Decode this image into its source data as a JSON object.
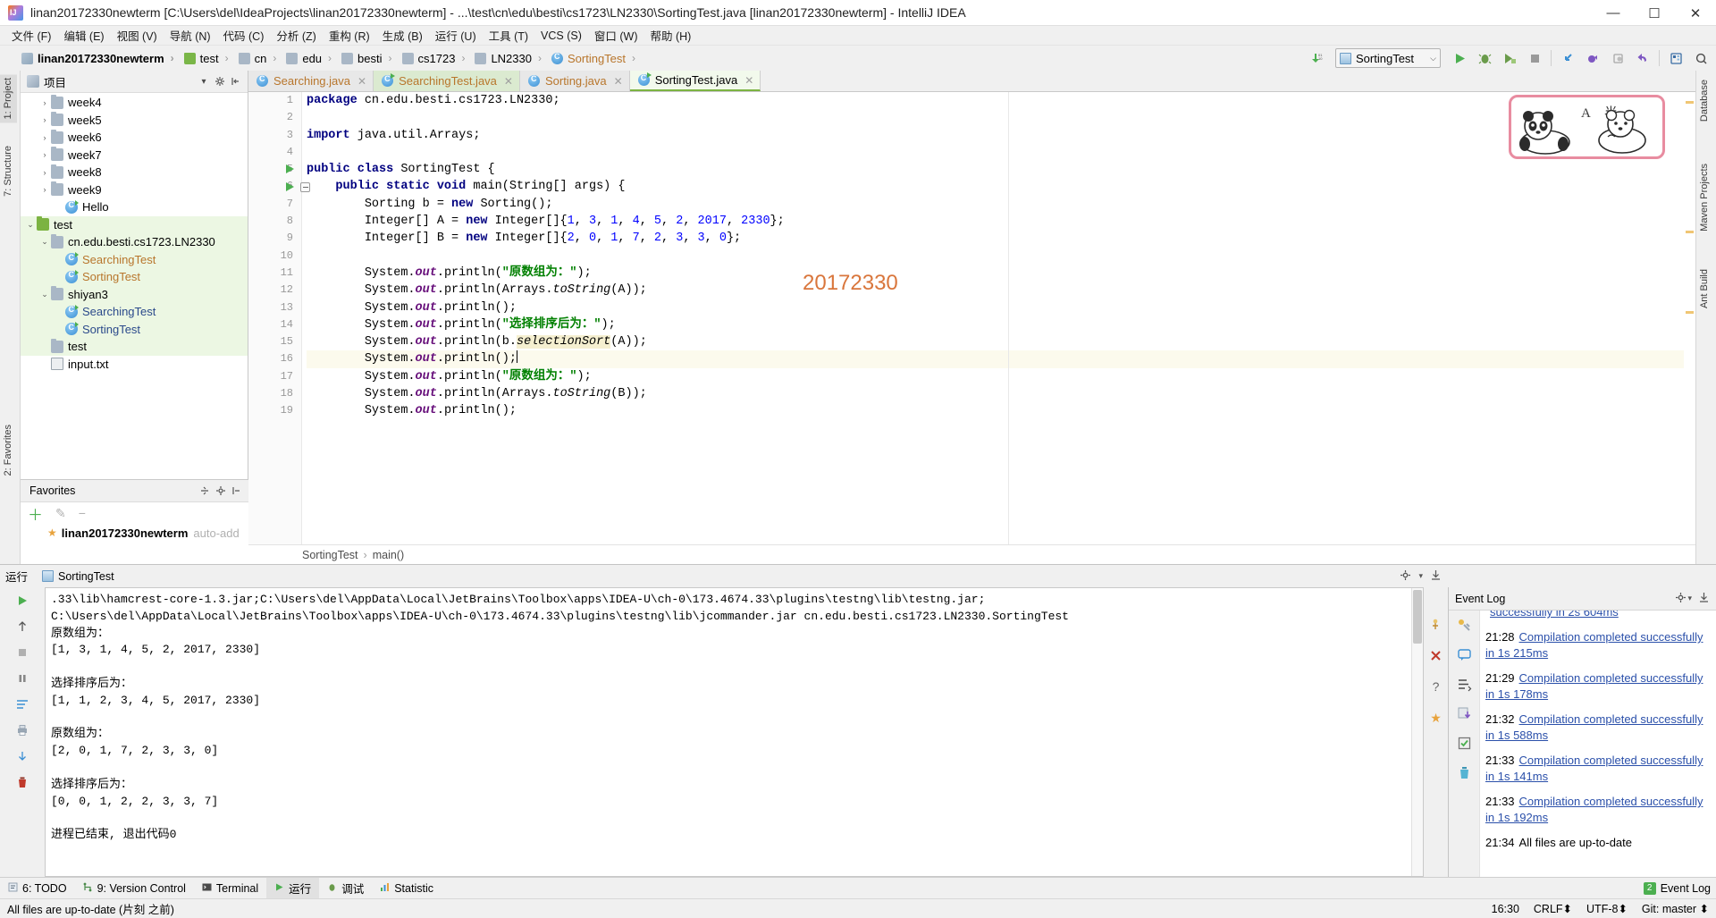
{
  "window": {
    "title": "linan20172330newterm [C:\\Users\\del\\IdeaProjects\\linan20172330newterm] - ...\\test\\cn\\edu\\besti\\cs1723\\LN2330\\SortingTest.java [linan20172330newterm] - IntelliJ IDEA",
    "app_icon": "IJ",
    "minimize": "—",
    "maximize": "☐",
    "close": "✕"
  },
  "menubar": {
    "items": [
      "文件 (F)",
      "编辑 (E)",
      "视图 (V)",
      "导航 (N)",
      "代码 (C)",
      "分析 (Z)",
      "重构 (R)",
      "生成 (B)",
      "运行 (U)",
      "工具 (T)",
      "VCS (S)",
      "窗口 (W)",
      "帮助 (H)"
    ]
  },
  "navbar": {
    "breadcrumbs": [
      {
        "label": "linan20172330newterm",
        "icon": "project-icon",
        "bold": true
      },
      {
        "label": "test",
        "icon": "folder-green-icon",
        "bold": false
      },
      {
        "label": "cn",
        "icon": "folder-icon",
        "bold": false
      },
      {
        "label": "edu",
        "icon": "folder-icon",
        "bold": false
      },
      {
        "label": "besti",
        "icon": "folder-icon",
        "bold": false
      },
      {
        "label": "cs1723",
        "icon": "folder-icon",
        "bold": false
      },
      {
        "label": "LN2330",
        "icon": "folder-icon",
        "bold": false
      },
      {
        "label": "SortingTest",
        "icon": "class-icon",
        "bold": false,
        "orange": true
      }
    ],
    "separator": "›",
    "run_config": "SortingTest",
    "run_config_chevron": "⌵",
    "update_icon": "download-updates-icon",
    "buttons": [
      {
        "name": "run-button",
        "glyph": "▶",
        "color": "#4caf50"
      },
      {
        "name": "debug-button",
        "glyph": "🐞",
        "color": "#6a9b4b"
      },
      {
        "name": "run-with-coverage-button",
        "glyph": "▶",
        "color": "#6a9b4b"
      },
      {
        "name": "stop-button",
        "glyph": "■",
        "color": "#9a9a9a"
      },
      {
        "name": "step-into-button",
        "glyph": "↙",
        "color": "#3b8fd4"
      },
      {
        "name": "toggle-breakpoint-button",
        "glyph": "●",
        "color": "#6a4b9b"
      },
      {
        "name": "view-breakpoints-button",
        "glyph": "◑",
        "color": "#9a9a9a"
      },
      {
        "name": "undo-button",
        "glyph": "↶",
        "color": "#6a4b9b"
      },
      {
        "name": "project-structure-button",
        "glyph": "▤",
        "color": "#3b6ea5"
      },
      {
        "name": "search-everywhere-button",
        "glyph": "⌕",
        "color": "#4a4a4a"
      }
    ]
  },
  "left_stripe": {
    "tabs": [
      {
        "label": "1: Project",
        "selected": true
      },
      {
        "label": "7: Structure",
        "selected": false
      },
      {
        "label": "2: Favorites",
        "selected": false
      }
    ]
  },
  "right_stripe": {
    "tabs": [
      "Database",
      "Maven Projects",
      "Ant Build"
    ]
  },
  "project_panel": {
    "title": "项目",
    "icon": "project-view-icon",
    "chevron": "▾",
    "settings_icon": "gear-icon",
    "collapse_icon": "collapse-all-icon",
    "tree": [
      {
        "label": "week4",
        "indent": 1,
        "arrow": "›",
        "icon": "folder-icon",
        "style": "normal"
      },
      {
        "label": "week5",
        "indent": 1,
        "arrow": "›",
        "icon": "folder-icon",
        "style": "normal"
      },
      {
        "label": "week6",
        "indent": 1,
        "arrow": "›",
        "icon": "folder-icon",
        "style": "normal"
      },
      {
        "label": "week7",
        "indent": 1,
        "arrow": "›",
        "icon": "folder-icon",
        "style": "normal"
      },
      {
        "label": "week8",
        "indent": 1,
        "arrow": "›",
        "icon": "folder-icon",
        "style": "normal"
      },
      {
        "label": "week9",
        "indent": 1,
        "arrow": "›",
        "icon": "folder-icon",
        "style": "normal"
      },
      {
        "label": "Hello",
        "indent": 2,
        "arrow": "",
        "icon": "class-icon-run",
        "style": "normal"
      },
      {
        "label": "test",
        "indent": 0,
        "arrow": "⌄",
        "icon": "folder-green-icon",
        "style": "green"
      },
      {
        "label": "cn.edu.besti.cs1723.LN2330",
        "indent": 1,
        "arrow": "⌄",
        "icon": "folder-icon",
        "style": "green"
      },
      {
        "label": "SearchingTest",
        "indent": 2,
        "arrow": "",
        "icon": "class-icon-run",
        "style": "green-orange"
      },
      {
        "label": "SortingTest",
        "indent": 2,
        "arrow": "",
        "icon": "class-icon-run",
        "style": "green-orange"
      },
      {
        "label": "shiyan3",
        "indent": 1,
        "arrow": "⌄",
        "icon": "folder-icon",
        "style": "green"
      },
      {
        "label": "SearchingTest",
        "indent": 2,
        "arrow": "",
        "icon": "class-icon-run",
        "style": "green-blue"
      },
      {
        "label": "SortingTest",
        "indent": 2,
        "arrow": "",
        "icon": "class-icon-run",
        "style": "green-blue"
      },
      {
        "label": "test",
        "indent": 1,
        "arrow": "",
        "icon": "folder-icon",
        "style": "green"
      },
      {
        "label": "input.txt",
        "indent": 1,
        "arrow": "",
        "icon": "text-file-icon",
        "style": "normal"
      }
    ]
  },
  "favorites_panel": {
    "title": "Favorites",
    "toolbar_icons": [
      "split-icon",
      "gear-icon",
      "collapse-icon"
    ],
    "actions": [
      "＋",
      "✎",
      "−"
    ],
    "item": "linan20172330newterm",
    "item_suffix": "auto-add"
  },
  "editor": {
    "tabs": [
      {
        "label": "Searching.java",
        "icon": "java-class-icon",
        "state": "inactive",
        "close": "✕"
      },
      {
        "label": "SearchingTest.java",
        "icon": "java-test-class-icon",
        "state": "modified",
        "close": "✕"
      },
      {
        "label": "Sorting.java",
        "icon": "java-class-icon",
        "state": "inactive",
        "close": "✕"
      },
      {
        "label": "SortingTest.java",
        "icon": "java-test-class-icon",
        "state": "active",
        "close": "✕"
      }
    ],
    "watermark": "20172330",
    "breadcrumb": {
      "class": "SortingTest",
      "method": "main()",
      "separator": "›"
    },
    "first_line": 1,
    "lines": [
      {
        "n": 1,
        "segments": [
          {
            "t": "package ",
            "c": "kw"
          },
          {
            "t": "cn.edu.besti.cs1723.LN2330;",
            "c": ""
          }
        ],
        "indent": 0
      },
      {
        "n": 2,
        "segments": [],
        "indent": 0
      },
      {
        "n": 3,
        "segments": [
          {
            "t": "import ",
            "c": "kw"
          },
          {
            "t": "java.util.Arrays;",
            "c": ""
          }
        ],
        "indent": 0
      },
      {
        "n": 4,
        "segments": [],
        "indent": 0
      },
      {
        "n": 5,
        "segments": [
          {
            "t": "public class ",
            "c": "kw"
          },
          {
            "t": "SortingTest {",
            "c": ""
          }
        ],
        "indent": 0,
        "gutter": "run"
      },
      {
        "n": 6,
        "segments": [
          {
            "t": "public static void ",
            "c": "kw"
          },
          {
            "t": "main(String[] args) {",
            "c": ""
          }
        ],
        "indent": 1,
        "gutter": "run-fold"
      },
      {
        "n": 7,
        "segments": [
          {
            "t": "Sorting b = ",
            "c": ""
          },
          {
            "t": "new ",
            "c": "kw"
          },
          {
            "t": "Sorting();",
            "c": ""
          }
        ],
        "indent": 2
      },
      {
        "n": 8,
        "segments": [
          {
            "t": "Integer[] A = ",
            "c": ""
          },
          {
            "t": "new ",
            "c": "kw"
          },
          {
            "t": "Integer[]{",
            "c": ""
          },
          {
            "t": "1",
            "c": "num"
          },
          {
            "t": ", ",
            "c": ""
          },
          {
            "t": "3",
            "c": "num"
          },
          {
            "t": ", ",
            "c": ""
          },
          {
            "t": "1",
            "c": "num"
          },
          {
            "t": ", ",
            "c": ""
          },
          {
            "t": "4",
            "c": "num"
          },
          {
            "t": ", ",
            "c": ""
          },
          {
            "t": "5",
            "c": "num"
          },
          {
            "t": ", ",
            "c": ""
          },
          {
            "t": "2",
            "c": "num"
          },
          {
            "t": ", ",
            "c": ""
          },
          {
            "t": "2017",
            "c": "num"
          },
          {
            "t": ", ",
            "c": ""
          },
          {
            "t": "2330",
            "c": "num"
          },
          {
            "t": "};",
            "c": ""
          }
        ],
        "indent": 2
      },
      {
        "n": 9,
        "segments": [
          {
            "t": "Integer[] B = ",
            "c": ""
          },
          {
            "t": "new ",
            "c": "kw"
          },
          {
            "t": "Integer[]{",
            "c": ""
          },
          {
            "t": "2",
            "c": "num"
          },
          {
            "t": ", ",
            "c": ""
          },
          {
            "t": "0",
            "c": "num"
          },
          {
            "t": ", ",
            "c": ""
          },
          {
            "t": "1",
            "c": "num"
          },
          {
            "t": ", ",
            "c": ""
          },
          {
            "t": "7",
            "c": "num"
          },
          {
            "t": ", ",
            "c": ""
          },
          {
            "t": "2",
            "c": "num"
          },
          {
            "t": ", ",
            "c": ""
          },
          {
            "t": "3",
            "c": "num"
          },
          {
            "t": ", ",
            "c": ""
          },
          {
            "t": "3",
            "c": "num"
          },
          {
            "t": ", ",
            "c": ""
          },
          {
            "t": "0",
            "c": "num"
          },
          {
            "t": "};",
            "c": ""
          }
        ],
        "indent": 2
      },
      {
        "n": 10,
        "segments": [],
        "indent": 0
      },
      {
        "n": 11,
        "segments": [
          {
            "t": "System.",
            "c": ""
          },
          {
            "t": "out",
            "c": "fld"
          },
          {
            "t": ".println(",
            "c": ""
          },
          {
            "t": "\"原数组为：\"",
            "c": "str"
          },
          {
            "t": ");",
            "c": ""
          }
        ],
        "indent": 2
      },
      {
        "n": 12,
        "segments": [
          {
            "t": "System.",
            "c": ""
          },
          {
            "t": "out",
            "c": "fld"
          },
          {
            "t": ".println(Arrays.",
            "c": ""
          },
          {
            "t": "toString",
            "c": "ital"
          },
          {
            "t": "(A));",
            "c": ""
          }
        ],
        "indent": 2
      },
      {
        "n": 13,
        "segments": [
          {
            "t": "System.",
            "c": ""
          },
          {
            "t": "out",
            "c": "fld"
          },
          {
            "t": ".println();",
            "c": ""
          }
        ],
        "indent": 2
      },
      {
        "n": 14,
        "segments": [
          {
            "t": "System.",
            "c": ""
          },
          {
            "t": "out",
            "c": "fld"
          },
          {
            "t": ".println(",
            "c": ""
          },
          {
            "t": "\"选择排序后为：\"",
            "c": "str"
          },
          {
            "t": ");",
            "c": ""
          }
        ],
        "indent": 2
      },
      {
        "n": 15,
        "segments": [
          {
            "t": "System.",
            "c": ""
          },
          {
            "t": "out",
            "c": "fld"
          },
          {
            "t": ".println(b.",
            "c": ""
          },
          {
            "t": "selectionSort",
            "c": "ital-hl"
          },
          {
            "t": "(A));",
            "c": ""
          }
        ],
        "indent": 2
      },
      {
        "n": 16,
        "segments": [
          {
            "t": "System.",
            "c": ""
          },
          {
            "t": "out",
            "c": "fld"
          },
          {
            "t": ".println();",
            "c": ""
          },
          {
            "t": "|",
            "c": "caret"
          }
        ],
        "indent": 2,
        "highlight": true
      },
      {
        "n": 17,
        "segments": [
          {
            "t": "System.",
            "c": ""
          },
          {
            "t": "out",
            "c": "fld"
          },
          {
            "t": ".println(",
            "c": ""
          },
          {
            "t": "\"原数组为：\"",
            "c": "str"
          },
          {
            "t": ");",
            "c": ""
          }
        ],
        "indent": 2
      },
      {
        "n": 18,
        "segments": [
          {
            "t": "System.",
            "c": ""
          },
          {
            "t": "out",
            "c": "fld"
          },
          {
            "t": ".println(Arrays.",
            "c": ""
          },
          {
            "t": "toString",
            "c": "ital"
          },
          {
            "t": "(B));",
            "c": ""
          }
        ],
        "indent": 2
      },
      {
        "n": 19,
        "segments": [
          {
            "t": "System.",
            "c": ""
          },
          {
            "t": "out",
            "c": "fld"
          },
          {
            "t": ".println();",
            "c": ""
          }
        ],
        "indent": 2
      }
    ]
  },
  "run_panel": {
    "label": "运行",
    "tab": "SortingTest",
    "settings_icon": "gear-icon",
    "hide_icon": "hide-icon",
    "tool_icons_left": [
      "▶",
      "↑",
      "■",
      "↻",
      "≡",
      "⎘",
      "⤓",
      "⏸"
    ],
    "tool_icons_right": [
      "⚡",
      "📌",
      "✕",
      "?",
      "★"
    ],
    "console_lines": [
      ".33\\lib\\hamcrest-core-1.3.jar;C:\\Users\\del\\AppData\\Local\\JetBrains\\Toolbox\\apps\\IDEA-U\\ch-0\\173.4674.33\\plugins\\testng\\lib\\testng.jar;",
      "C:\\Users\\del\\AppData\\Local\\JetBrains\\Toolbox\\apps\\IDEA-U\\ch-0\\173.4674.33\\plugins\\testng\\lib\\jcommander.jar cn.edu.besti.cs1723.LN2330.SortingTest",
      "原数组为：",
      "[1, 3, 1, 4, 5, 2, 2017, 2330]",
      "",
      "选择排序后为：",
      "[1, 1, 2, 3, 4, 5, 2017, 2330]",
      "",
      "原数组为：",
      "[2, 0, 1, 7, 2, 3, 3, 0]",
      "",
      "选择排序后为：",
      "[0, 0, 1, 2, 2, 3, 3, 7]",
      "",
      "进程已结束, 退出代码0"
    ]
  },
  "event_log": {
    "title": "Event Log",
    "settings_icon": "gear-icon",
    "hide_icon": "hide-icon",
    "icons": [
      "build-icon",
      "message-icon",
      "sort-icon",
      "export-icon",
      "mark-read-icon",
      "trash-icon"
    ],
    "entries": [
      {
        "time": "",
        "text": "successfully in 2s 604ms",
        "partial": true
      },
      {
        "time": "21:28",
        "text": "Compilation completed successfully in 1s 215ms"
      },
      {
        "time": "21:29",
        "text": "Compilation completed successfully in 1s 178ms"
      },
      {
        "time": "21:32",
        "text": "Compilation completed successfully in 1s 588ms"
      },
      {
        "time": "21:33",
        "text": "Compilation completed successfully in 1s 141ms"
      },
      {
        "time": "21:33",
        "text": "Compilation completed successfully in 1s 192ms"
      },
      {
        "time": "21:34",
        "text": "All files are up-to-date",
        "plain": true
      }
    ]
  },
  "toolwindow_bar": {
    "items": [
      {
        "label": "6: TODO",
        "icon": "todo-icon",
        "active": false
      },
      {
        "label": "9: Version Control",
        "icon": "vcs-icon",
        "active": false
      },
      {
        "label": "Terminal",
        "icon": "terminal-icon",
        "active": false
      },
      {
        "label": "运行",
        "icon": "run-icon",
        "active": true
      },
      {
        "label": "调试",
        "icon": "debug-icon",
        "active": false
      },
      {
        "label": "Statistic",
        "icon": "statistic-icon",
        "active": false
      }
    ],
    "right_item": {
      "label": "Event Log",
      "badge": "2",
      "icon": "event-log-icon"
    }
  },
  "statusbar": {
    "message": "All files are up-to-date (片刻 之前)",
    "time": "16:30",
    "line_separator": "CRLF⬍",
    "encoding": "UTF-8⬍",
    "branch": "Git: master ⬍"
  }
}
